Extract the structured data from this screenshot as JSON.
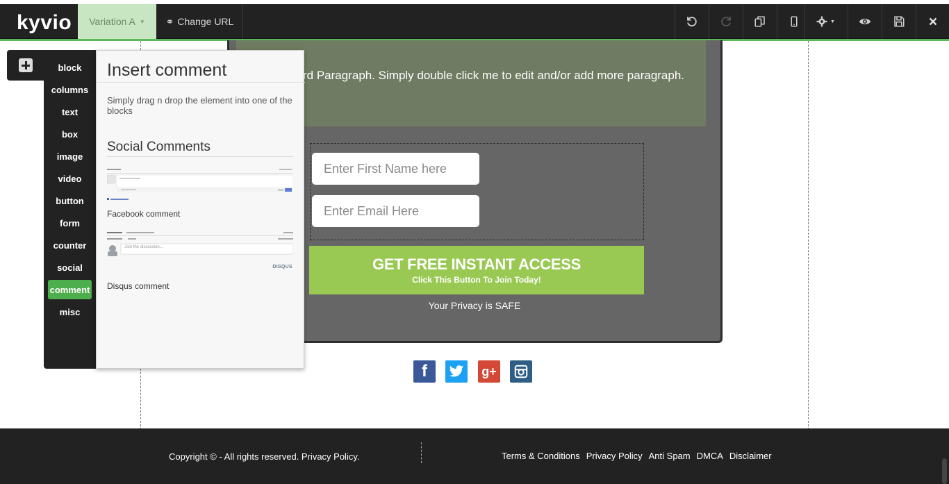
{
  "toolbar": {
    "logo": "kyvio",
    "variation_label": "Variation A",
    "change_url_label": "Change URL",
    "buttons": [
      "undo-icon",
      "redo-icon",
      "copy-icon",
      "mobile-icon",
      "gear-icon",
      "eye-icon",
      "save-icon",
      "close-icon"
    ]
  },
  "sidebar": {
    "items": [
      {
        "label": "block"
      },
      {
        "label": "columns"
      },
      {
        "label": "text"
      },
      {
        "label": "box"
      },
      {
        "label": "image"
      },
      {
        "label": "video"
      },
      {
        "label": "button"
      },
      {
        "label": "form"
      },
      {
        "label": "counter"
      },
      {
        "label": "social"
      },
      {
        "label": "comment",
        "active": true
      },
      {
        "label": "misc"
      }
    ]
  },
  "insert_panel": {
    "title": "Insert comment",
    "description": "Simply drag n drop the element into one of the blocks",
    "section_title": "Social Comments",
    "facebook_label": "Facebook comment",
    "disqus_label": "Disqus comment",
    "disqus_thumb": {
      "placeholder": "Join the discussion...",
      "brand": "DISQUS"
    }
  },
  "page": {
    "paragraph": "standard Paragraph. Simply double click me to edit and/or add more paragraph.",
    "form": {
      "first_name_placeholder": "Enter First Name here",
      "email_placeholder": "Enter Email Here"
    },
    "cta": {
      "title": "GET FREE INSTANT ACCESS",
      "subtitle": "Click This Button To Join Today!"
    },
    "privacy": "Your Privacy is SAFE",
    "social_icons": [
      {
        "name": "facebook-icon",
        "glyph": "f",
        "color": "#3b5998"
      },
      {
        "name": "twitter-icon",
        "glyph": "t",
        "color": "#1da1f2"
      },
      {
        "name": "google-plus-icon",
        "glyph": "g+",
        "color": "#d34836"
      },
      {
        "name": "instagram-icon",
        "glyph": "◎",
        "color": "#2e5e86"
      }
    ]
  },
  "footer": {
    "copyright": "Copyright © - All rights reserved. Privacy Policy.",
    "links": [
      "Terms & Conditions",
      "Privacy Policy",
      "Anti Spam",
      "DMCA",
      "Disclaimer"
    ]
  },
  "colors": {
    "accent_green": "#5cb85c",
    "cta_green": "#99c952",
    "toolbar_bg": "#222222"
  }
}
